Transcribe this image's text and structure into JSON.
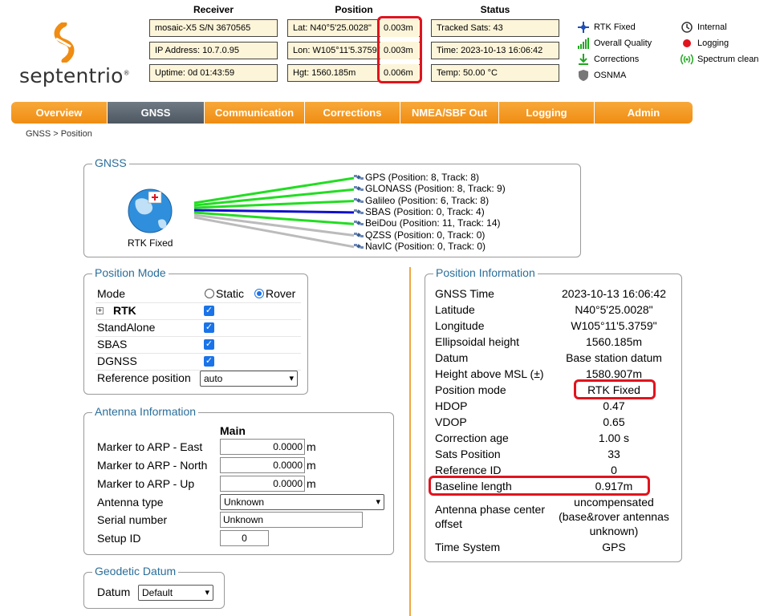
{
  "brand": {
    "name": "septentrio",
    "trademark": "®"
  },
  "header": {
    "receiver": {
      "title": "Receiver",
      "lines": [
        "mosaic-X5 S/N 3670565",
        "IP Address: 10.7.0.95",
        "Uptime: 0d 01:43:59"
      ]
    },
    "position": {
      "title": "Position",
      "lines": [
        {
          "label": "Lat:  N40°5'25.0028\"",
          "accuracy": "0.003m"
        },
        {
          "label": "Lon: W105°11'5.3759\"",
          "accuracy": "0.003m"
        },
        {
          "label": "Hgt: 1560.185m",
          "accuracy": "0.006m"
        }
      ]
    },
    "status": {
      "title": "Status",
      "lines": [
        "Tracked Sats: 43",
        "Time: 2023-10-13 16:06:42",
        "Temp: 50.00 °C"
      ]
    },
    "legend": [
      {
        "icon": "satellite-icon",
        "label": "RTK Fixed",
        "color": "#1f4fb5"
      },
      {
        "icon": "signal-bars-icon",
        "label": "Overall Quality",
        "color": "#21a821"
      },
      {
        "icon": "download-arrow-icon",
        "label": "Corrections",
        "color": "#21a821"
      },
      {
        "icon": "shield-icon",
        "label": "OSNMA",
        "color": "#777777"
      },
      {
        "icon": "clock-icon",
        "label": "Internal",
        "color": "#333333"
      },
      {
        "icon": "red-dot-icon",
        "label": "Logging",
        "color": "#e0141e"
      },
      {
        "icon": "spectrum-icon",
        "label": "Spectrum clean",
        "color": "#21a821"
      }
    ]
  },
  "nav": {
    "tabs": [
      "Overview",
      "GNSS",
      "Communication",
      "Corrections",
      "NMEA/SBF Out",
      "Logging",
      "Admin"
    ],
    "active": "GNSS"
  },
  "breadcrumb": "GNSS > Position",
  "gnss": {
    "legend": "GNSS",
    "globe_label": "RTK Fixed",
    "constellations": [
      {
        "text": "GPS (Position: 8, Track: 8)",
        "color": "#22dd22"
      },
      {
        "text": "GLONASS (Position: 8, Track: 9)",
        "color": "#22dd22"
      },
      {
        "text": "Galileo (Position: 6, Track: 8)",
        "color": "#22dd22"
      },
      {
        "text": "SBAS (Position: 0, Track: 4)",
        "color": "#1010cc"
      },
      {
        "text": "BeiDou (Position: 11, Track: 14)",
        "color": "#22dd22"
      },
      {
        "text": "QZSS (Position: 0, Track: 0)",
        "color": "#bbbbbb"
      },
      {
        "text": "NavIC (Position: 0, Track: 0)",
        "color": "#bbbbbb"
      }
    ]
  },
  "position_mode": {
    "legend": "Position Mode",
    "mode_label": "Mode",
    "static_label": "Static",
    "rover_label": "Rover",
    "rtk_label": "RTK",
    "standalone_label": "StandAlone",
    "sbas_label": "SBAS",
    "dgnss_label": "DGNSS",
    "refpos_label": "Reference position",
    "refpos_value": "auto"
  },
  "antenna": {
    "legend": "Antenna Information",
    "column": "Main",
    "east_label": "Marker to ARP - East",
    "east_value": "0.0000",
    "north_label": "Marker to ARP - North",
    "north_value": "0.0000",
    "up_label": "Marker to ARP - Up",
    "up_value": "0.0000",
    "unit": "m",
    "type_label": "Antenna type",
    "type_value": "Unknown",
    "serial_label": "Serial number",
    "serial_value": "Unknown",
    "setup_label": "Setup ID",
    "setup_value": "0"
  },
  "datum": {
    "legend": "Geodetic Datum",
    "label": "Datum",
    "value": "Default"
  },
  "position_info": {
    "legend": "Position Information",
    "rows": [
      {
        "label": "GNSS Time",
        "value": "2023-10-13 16:06:42"
      },
      {
        "label": "Latitude",
        "value": "N40°5'25.0028\""
      },
      {
        "label": "Longitude",
        "value": "W105°11'5.3759\""
      },
      {
        "label": "Ellipsoidal height",
        "value": "1560.185m"
      },
      {
        "label": "Datum",
        "value": "Base station datum"
      },
      {
        "label": "Height above MSL (±)",
        "value": "1580.907m"
      },
      {
        "label": "Position mode",
        "value": "RTK Fixed"
      },
      {
        "label": "HDOP",
        "value": "0.47"
      },
      {
        "label": "VDOP",
        "value": "0.65"
      },
      {
        "label": "Correction age",
        "value": "1.00 s"
      },
      {
        "label": "Sats Position",
        "value": "33"
      },
      {
        "label": "Reference ID",
        "value": "0"
      },
      {
        "label": "Baseline length",
        "value": "0.917m"
      }
    ],
    "phase_label_1": "Antenna phase center",
    "phase_label_2": "offset",
    "phase_value_1": "uncompensated",
    "phase_value_2": "(base&rover antennas",
    "phase_value_3": "unknown)",
    "time_system_label": "Time System",
    "time_system_value": "GPS"
  }
}
